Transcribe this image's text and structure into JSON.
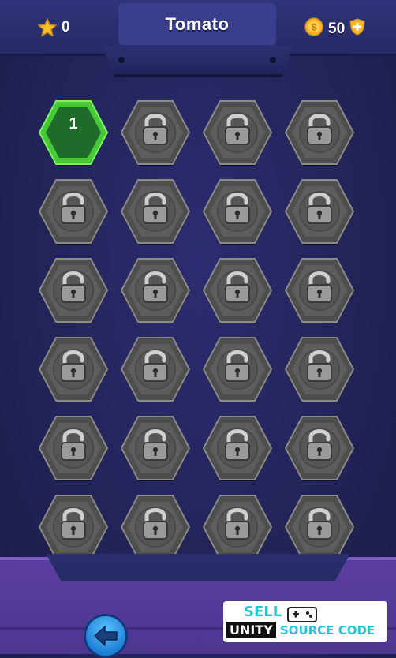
{
  "header": {
    "title": "Tomato",
    "stars": "0",
    "coins": "50"
  },
  "levels": [
    {
      "number": "1",
      "state": "unlocked"
    },
    {
      "number": "",
      "state": "locked"
    },
    {
      "number": "",
      "state": "locked"
    },
    {
      "number": "",
      "state": "locked"
    },
    {
      "number": "",
      "state": "locked"
    },
    {
      "number": "",
      "state": "locked"
    },
    {
      "number": "",
      "state": "locked"
    },
    {
      "number": "",
      "state": "locked"
    },
    {
      "number": "",
      "state": "locked"
    },
    {
      "number": "",
      "state": "locked"
    },
    {
      "number": "",
      "state": "locked"
    },
    {
      "number": "",
      "state": "locked"
    },
    {
      "number": "",
      "state": "locked"
    },
    {
      "number": "",
      "state": "locked"
    },
    {
      "number": "",
      "state": "locked"
    },
    {
      "number": "",
      "state": "locked"
    },
    {
      "number": "",
      "state": "locked"
    },
    {
      "number": "",
      "state": "locked"
    },
    {
      "number": "",
      "state": "locked"
    },
    {
      "number": "",
      "state": "locked"
    },
    {
      "number": "",
      "state": "locked"
    },
    {
      "number": "",
      "state": "locked"
    },
    {
      "number": "",
      "state": "locked"
    },
    {
      "number": "",
      "state": "locked"
    }
  ],
  "icons": {
    "star": "star-icon",
    "coin": "coin-icon",
    "shield": "shield-plus-icon",
    "lock": "padlock-icon",
    "back": "left-arrow-icon"
  },
  "colors": {
    "unlocked": "#5fd54a",
    "locked": "#6b6b6b",
    "accent_coin": "#f7b52a"
  },
  "watermark": {
    "line1": "SELL",
    "line2": "UNITY",
    "line3": "SOURCE CODE"
  }
}
